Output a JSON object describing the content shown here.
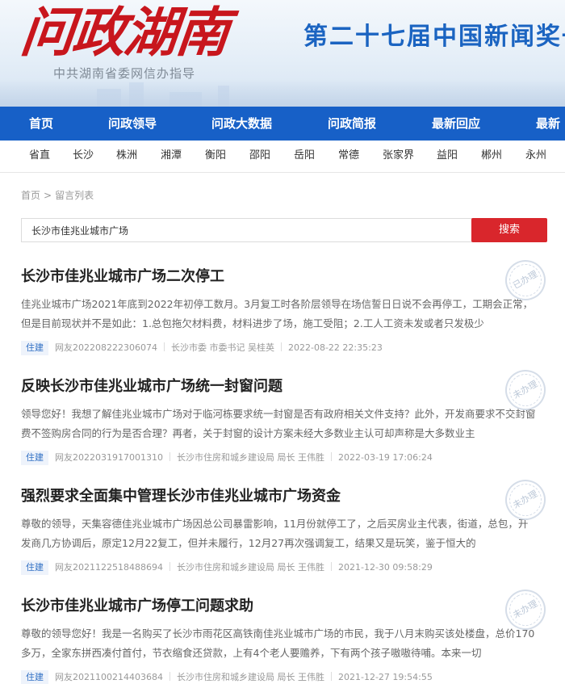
{
  "header": {
    "logo_text": "问政湖南",
    "sub_title": "中共湖南省委网信办指导",
    "slogan": "第二十七届中国新闻奖一"
  },
  "main_nav": [
    "首页",
    "问政领导",
    "问政大数据",
    "问政简报",
    "最新回应",
    "最新"
  ],
  "city_nav": [
    "省直",
    "长沙",
    "株洲",
    "湘潭",
    "衡阳",
    "邵阳",
    "岳阳",
    "常德",
    "张家界",
    "益阳",
    "郴州",
    "永州"
  ],
  "breadcrumb": {
    "home": "首页",
    "separator": ">",
    "current": "留言列表"
  },
  "search": {
    "value": "长沙市佳兆业城市广场",
    "button_label": "搜索"
  },
  "posts": [
    {
      "title": "长沙市佳兆业城市广场二次停工",
      "body": "佳兆业城市广场2021年底到2022年初停工数月。3月复工时各阶层领导在场信誓日日说不会再停工，工期会正常，但是目前现状并不是如此：1.总包拖欠材料费，材料进步了场，施工受阻；2.工人工资未发或者只发极少",
      "tag": "住建",
      "user": "网友20220822230607​4",
      "dept": "长沙市委 市委书记 吴桂英",
      "time": "2022-08-22 22:35:23",
      "status": "已办理"
    },
    {
      "title": "反映长沙市佳兆业城市广场统一封窗问题",
      "body": "领导您好！我想了解佳兆业城市广场对于临河栋要求统一封窗是否有政府相关文件支持？此外，开发商要求不交封窗费不签购房合同的行为是否合理？再者，关于封窗的设计方案未经大多数业主认可却声称是大多数业主",
      "tag": "住建",
      "user": "网友2022031917001310",
      "dept": "长沙市住房和城乡建设局 局长 王伟胜",
      "time": "2022-03-19 17:06:24",
      "status": "未办理"
    },
    {
      "title": "强烈要求全面集中管理长沙市佳兆业城市广场资金",
      "body": "尊敬的领导，天集容德佳兆业城市广场因总公司暴雷影响，11月份就停工了，之后买房业主代表，街道，总包，开发商几方协调后，原定12月22复工，但并未履行，12月27再次强调复工，结果又是玩笑，鉴于恒大的",
      "tag": "住建",
      "user": "网友2021122518488694",
      "dept": "长沙市住房和城乡建设局 局长 王伟胜",
      "time": "2021-12-30 09:58:29",
      "status": "未办理"
    },
    {
      "title": "长沙市佳兆业城市广场停工问题求助",
      "body": "尊敬的领导您好！我是一名购买了长沙市雨花区高铁南佳兆业城市广场的市民，我于八月末购买该处楼盘，总价170多万，全家东拼西凑付首付，节衣缩食还贷款，上有4个老人要赡养，下有两个孩子嗷嗷待哺。本来一切",
      "tag": "住建",
      "user": "网友2021100214403684",
      "dept": "长沙市住房和城乡建设局 局长 王伟胜",
      "time": "2021-12-27 19:54:55",
      "status": "未办理"
    }
  ],
  "colors": {
    "brand_red": "#c8161d",
    "nav_blue": "#1760c7",
    "search_button": "#d9262c"
  }
}
